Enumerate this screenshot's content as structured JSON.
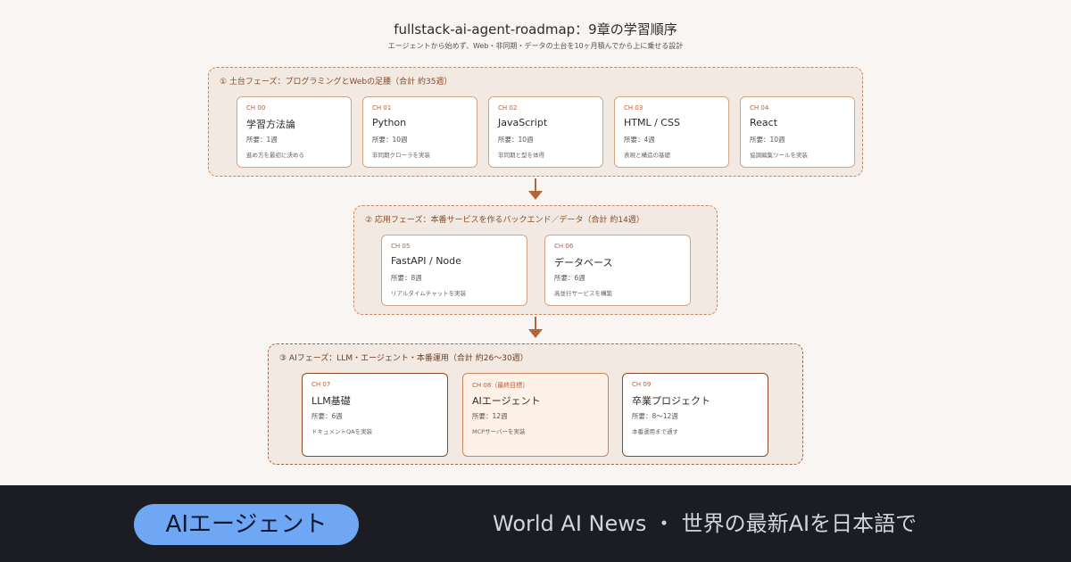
{
  "header": {
    "title": "fullstack-ai-agent-roadmap：9章の学習順序",
    "subtitle": "エージェントから始めず、Web・非同期・データの土台を10ヶ月積んでから上に乗せる設計"
  },
  "phases": [
    {
      "label": "① 土台フェーズ：プログラミングとWebの足腰（合計 約35週）",
      "cards": [
        {
          "ch": "CH 00",
          "name": "学習方法論",
          "duration": "所要：1週",
          "desc": "進め方を最初に決める"
        },
        {
          "ch": "CH 01",
          "name": "Python",
          "duration": "所要：10週",
          "desc": "非同期クローラを実装"
        },
        {
          "ch": "CH 02",
          "name": "JavaScript",
          "duration": "所要：10週",
          "desc": "非同期と型を体得"
        },
        {
          "ch": "CH 03",
          "name": "HTML / CSS",
          "duration": "所要：4週",
          "desc": "表現と構造の基礎"
        },
        {
          "ch": "CH 04",
          "name": "React",
          "duration": "所要：10週",
          "desc": "協調編集ツールを実装"
        }
      ]
    },
    {
      "label": "② 応用フェーズ：本番サービスを作るバックエンド／データ（合計 約14週）",
      "cards": [
        {
          "ch": "CH 05",
          "name": "FastAPI / Node",
          "duration": "所要：8週",
          "desc": "リアルタイムチャットを実装"
        },
        {
          "ch": "CH 06",
          "name": "データベース",
          "duration": "所要：6週",
          "desc": "高並行サービスを構築"
        }
      ]
    },
    {
      "label": "③ AIフェーズ：LLM・エージェント・本番運用（合計 約26〜30週）",
      "cards": [
        {
          "ch": "CH 07",
          "name": "LLM基礎",
          "duration": "所要：6週",
          "desc": "ドキュメントQAを実装"
        },
        {
          "ch": "CH 08（最終目標）",
          "name": "AIエージェント",
          "duration": "所要：12週",
          "desc": "MCPサーバーを実装"
        },
        {
          "ch": "CH 09",
          "name": "卒業プロジェクト",
          "duration": "所要：8〜12週",
          "desc": "本番運用まで通す"
        }
      ]
    }
  ],
  "footer": {
    "badge": "AIエージェント",
    "text": "World AI News ・ 世界の最新AIを日本語で"
  },
  "colors": {
    "accent": "#b5653a",
    "phase_border": "#c9865a",
    "phase_bg": "#f1e9e2",
    "badge_bg": "#6fa7f5",
    "footer_bg": "#1b1d22"
  }
}
